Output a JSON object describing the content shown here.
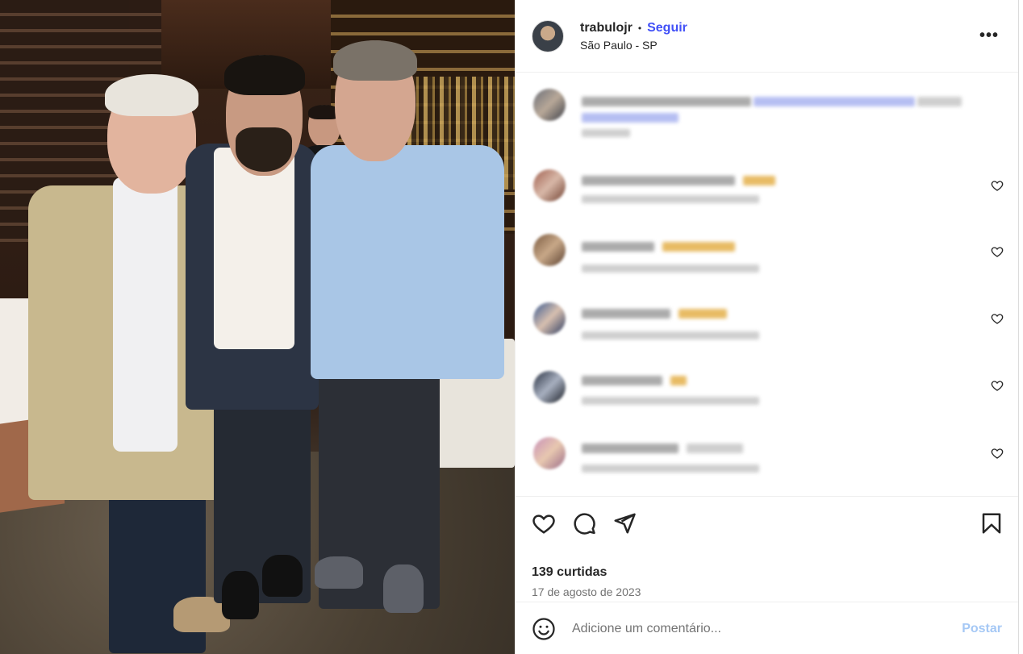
{
  "photo": {
    "description_icon": "post-photo"
  },
  "header": {
    "username": "trabulojr",
    "separator": "•",
    "follow_label": "Seguir",
    "location": "São Paulo - SP",
    "more_icon": "more-options-icon"
  },
  "comments": {
    "note": "",
    "items_count_visible": 6
  },
  "actions": {
    "like_icon": "heart-icon",
    "comment_icon": "comment-icon",
    "share_icon": "send-icon",
    "save_icon": "bookmark-icon"
  },
  "stats": {
    "likes": "139 curtidas",
    "date": "17 de agosto de 2023"
  },
  "add_comment": {
    "emoji_icon": "emoji-icon",
    "placeholder": "Adicione um comentário...",
    "post_label": "Postar"
  },
  "colors": {
    "follow": "#4150f7",
    "post_disabled": "#a5c8f5",
    "text": "#262626",
    "muted": "#737373",
    "border": "#efefef"
  }
}
